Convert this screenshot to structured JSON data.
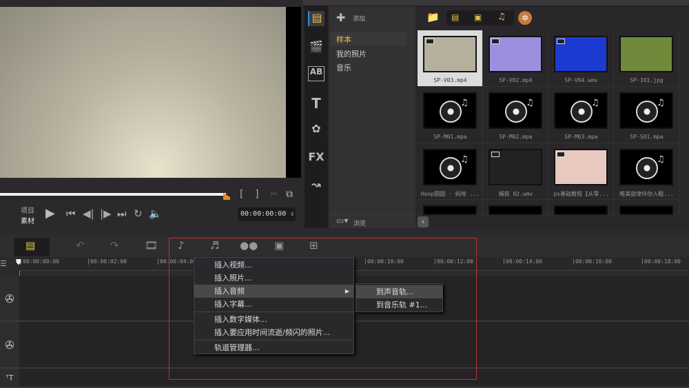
{
  "preview": {
    "label_project": "项目",
    "label_clip": "素材",
    "timecode": "00:00:00:00",
    "mark_in": "[",
    "mark_out": "]",
    "progress": 1.0
  },
  "library": {
    "add_label": "添加",
    "browse_label": "浏览",
    "folders": [
      "样本",
      "我的照片",
      "音乐"
    ],
    "side_icons": [
      "media-icon",
      "instant-project-icon",
      "transition-icon",
      "title-icon",
      "graphic-icon",
      "filter-icon",
      "path-icon"
    ],
    "items": [
      {
        "name": "SP-V03.mp4",
        "type": "video",
        "color": "#b5b09e"
      },
      {
        "name": "SP-V02.mp4",
        "type": "video",
        "color": "#9b8fe0"
      },
      {
        "name": "SP-V04.wmv",
        "type": "video",
        "color": "#1c3ad0"
      },
      {
        "name": "SP-I01.jpg",
        "type": "image",
        "color": "#6e8a3a"
      },
      {
        "name": "SP-M01.mpa",
        "type": "audio"
      },
      {
        "name": "SP-M02.mpa",
        "type": "audio"
      },
      {
        "name": "SP-M03.mpa",
        "type": "audio"
      },
      {
        "name": "SP-S01.mpa",
        "type": "audio"
      },
      {
        "name": "Hoop圆圆 - 妈咪 ...",
        "type": "audio"
      },
      {
        "name": "捕获 02.wmv",
        "type": "video",
        "color": "#222"
      },
      {
        "name": "ps基础教程【从零...",
        "type": "video",
        "color": "#e8c9c0"
      },
      {
        "name": "唯美旋律伴你入眠...",
        "type": "audio"
      }
    ]
  },
  "timeline": {
    "ticks": [
      "00:00:00:00",
      "00:00:02:00",
      "00:00:04:00",
      "00:00:10:00",
      "00:00:12:00",
      "00:00:14:00",
      "00:00:16:00",
      "00:00:18:00"
    ]
  },
  "context_menu": {
    "items": [
      "插入视频...",
      "插入照片...",
      "插入音频",
      "插入字幕...",
      "插入数字媒体...",
      "插入要应用时间流逝/频闪的照片...",
      "轨道管理器..."
    ],
    "submenu": [
      "到声音轨...",
      "到音乐轨 #1..."
    ]
  }
}
